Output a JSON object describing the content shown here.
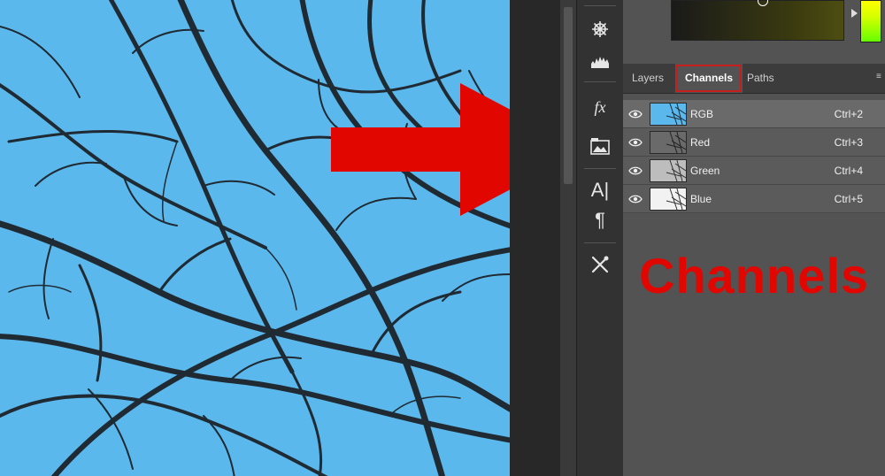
{
  "panel": {
    "tabs": [
      {
        "label": "Layers",
        "active": false
      },
      {
        "label": "Channels",
        "active": true
      },
      {
        "label": "Paths",
        "active": false
      }
    ],
    "channels": [
      {
        "label": "RGB",
        "shortcut": "Ctrl+2",
        "selected": true
      },
      {
        "label": "Red",
        "shortcut": "Ctrl+3",
        "selected": false
      },
      {
        "label": "Green",
        "shortcut": "Ctrl+4",
        "selected": false
      },
      {
        "label": "Blue",
        "shortcut": "Ctrl+5",
        "selected": false
      }
    ]
  },
  "annotation": {
    "text": "Channels",
    "color": "#e10600"
  },
  "toolstrip": {
    "icons": [
      "navigator-icon",
      "histogram-icon",
      "fx-icon",
      "adjustments-icon",
      "character-icon",
      "paragraph-icon",
      "tools-icon"
    ]
  },
  "colors": {
    "sky": "#5bb8ec",
    "branches": "#1f2a33",
    "panel_bg": "#535353",
    "highlight": "#c81d1d"
  }
}
